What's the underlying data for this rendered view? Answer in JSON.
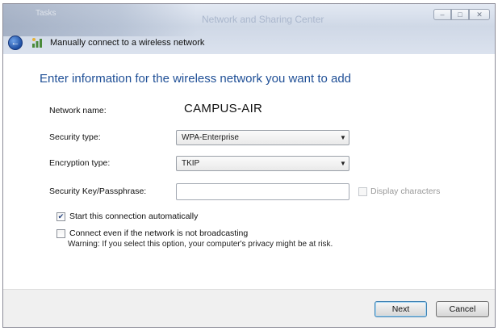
{
  "titlebar": {
    "app_title": "Tasks",
    "window_title": "Network and Sharing Center",
    "caption_buttons": {
      "minimize": "–",
      "maximize": "□",
      "close": "✕"
    }
  },
  "nav": {
    "wizard_title": "Manually connect to a wireless network"
  },
  "content": {
    "heading": "Enter information for the wireless network you want to add",
    "network_name_label": "Network name:",
    "network_name_value": "CAMPUS-AIR",
    "security_type_label": "Security type:",
    "security_type_value": "WPA-Enterprise",
    "encryption_type_label": "Encryption type:",
    "encryption_type_value": "TKIP",
    "passphrase_label": "Security Key/Passphrase:",
    "passphrase_value": "",
    "display_characters_label": "Display characters",
    "display_characters_checked": false,
    "start_auto_label": "Start this connection automatically",
    "start_auto_checked": true,
    "connect_hidden_label": "Connect even if the network is not broadcasting",
    "connect_hidden_checked": false,
    "warning_text": "Warning: If you select this option, your computer's privacy might be at risk."
  },
  "footer": {
    "next_label": "Next",
    "cancel_label": "Cancel"
  },
  "colors": {
    "heading": "#1f4f96",
    "back_button": "#1e4fa3"
  },
  "icons": {
    "back": "back-arrow-icon",
    "network": "network-icon",
    "dropdown": "chevron-down-icon",
    "check": "checkmark-icon"
  }
}
